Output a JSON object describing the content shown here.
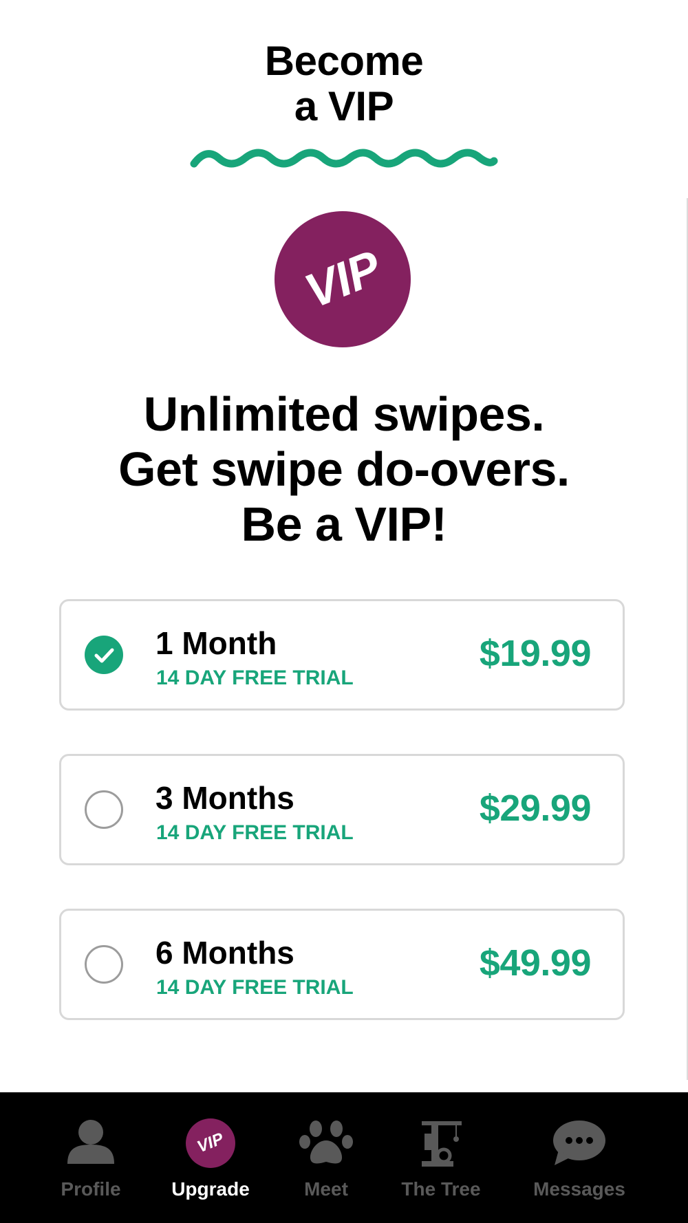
{
  "header": {
    "title_line1": "Become",
    "title_line2": "a VIP"
  },
  "badge": {
    "text": "VIP",
    "color": "#84215f"
  },
  "tagline": {
    "line1": "Unlimited swipes.",
    "line2": "Get swipe do-overs.",
    "line3": "Be a VIP!"
  },
  "plans": [
    {
      "name": "1 Month",
      "trial": "14 DAY FREE TRIAL",
      "price": "$19.99",
      "selected": true
    },
    {
      "name": "3 Months",
      "trial": "14 DAY FREE TRIAL",
      "price": "$29.99",
      "selected": false
    },
    {
      "name": "6 Months",
      "trial": "14 DAY FREE TRIAL",
      "price": "$49.99",
      "selected": false
    }
  ],
  "nav": {
    "items": [
      {
        "label": "Profile",
        "icon": "person-icon",
        "active": false
      },
      {
        "label": "Upgrade",
        "icon": "vip-badge-icon",
        "active": true,
        "badge_text": "VIP"
      },
      {
        "label": "Meet",
        "icon": "paw-icon",
        "active": false
      },
      {
        "label": "The Tree",
        "icon": "cat-tree-icon",
        "active": false
      },
      {
        "label": "Messages",
        "icon": "chat-bubble-icon",
        "active": false
      }
    ]
  },
  "colors": {
    "accent_green": "#18a57a",
    "vip_purple": "#84215f",
    "nav_background": "#000000",
    "nav_inactive": "#595959",
    "nav_active": "#ffffff"
  }
}
